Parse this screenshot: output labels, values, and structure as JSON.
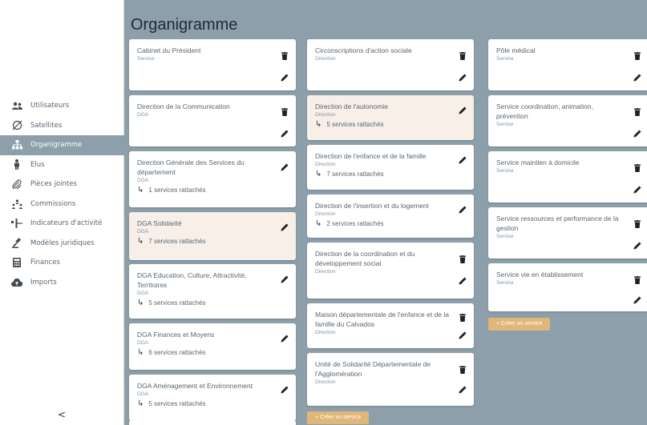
{
  "title": "Organigramme",
  "sidebar": {
    "items": [
      {
        "label": "Utilisateurs",
        "icon": "users-icon",
        "active": false
      },
      {
        "label": "Satellites",
        "icon": "satellite-icon",
        "active": false
      },
      {
        "label": "Organigramme",
        "icon": "sitemap-icon",
        "active": true
      },
      {
        "label": "Elus",
        "icon": "person-icon",
        "active": false
      },
      {
        "label": "Pièces jointes",
        "icon": "paperclip-icon",
        "active": false
      },
      {
        "label": "Commissions",
        "icon": "people-group-icon",
        "active": false
      },
      {
        "label": "Indicateurs d'activité",
        "icon": "indicator-icon",
        "active": false
      },
      {
        "label": "Modèles juridiques",
        "icon": "gavel-icon",
        "active": false
      },
      {
        "label": "Finances",
        "icon": "calculator-icon",
        "active": false
      },
      {
        "label": "Imports",
        "icon": "cloud-upload-icon",
        "active": false
      }
    ],
    "collapse_label": "<"
  },
  "columns": [
    {
      "cards": [
        {
          "title": "Cabinet du Président",
          "type": "Service",
          "link": "",
          "highlight": false
        },
        {
          "title": "Direction de la Communication",
          "type": "DGA",
          "link": "",
          "highlight": false
        },
        {
          "title": "Direction Générale des Services du département",
          "type": "DGA",
          "link": "1 services rattachés",
          "highlight": false
        },
        {
          "title": "DGA Solidarité",
          "type": "DGA",
          "link": "7 services rattachés",
          "highlight": true
        },
        {
          "title": "DGA Education, Culture, Attractivité, Territoires",
          "type": "DGA",
          "link": "5 services rattachés",
          "highlight": false
        },
        {
          "title": "DGA Finances et Moyens",
          "type": "DGA",
          "link": "6 services rattachés",
          "highlight": false
        },
        {
          "title": "DGA Aménagement et Environnement",
          "type": "DGA",
          "link": "5 services rattachés",
          "highlight": false
        }
      ]
    },
    {
      "cards": [
        {
          "title": "Circonscriptions d'action sociale",
          "type": "Direction",
          "link": "",
          "highlight": false
        },
        {
          "title": "Direction de l'autonomie",
          "type": "Direction",
          "link": "5 services rattachés",
          "highlight": true
        },
        {
          "title": "Direction de l'enfance et de la famille",
          "type": "Direction",
          "link": "7 services rattachés",
          "highlight": false
        },
        {
          "title": "Direction de l'insertion et du logement",
          "type": "Direction",
          "link": "2 services rattachés",
          "highlight": false
        },
        {
          "title": "Direction de la coordination et du développement social",
          "type": "Direction",
          "link": "",
          "highlight": false
        },
        {
          "title": "Maison départementale de l'enfance et de la famille du Calvados",
          "type": "Direction",
          "link": "",
          "highlight": false
        },
        {
          "title": "Unité de Solidarité Départementale de l'Agglomération",
          "type": "Direction",
          "link": "",
          "highlight": false
        }
      ],
      "add_label": "+ Créer un service"
    },
    {
      "cards": [
        {
          "title": "Pôle médical",
          "type": "Service",
          "link": "",
          "highlight": false
        },
        {
          "title": "Service coordination, animation, prévention",
          "type": "Service",
          "link": "",
          "highlight": false
        },
        {
          "title": "Service maintien à domicile",
          "type": "Service",
          "link": "",
          "highlight": false
        },
        {
          "title": "Service ressources et performance de la gestion",
          "type": "Service",
          "link": "",
          "highlight": false
        },
        {
          "title": "Service vie en établissement",
          "type": "Service",
          "link": "",
          "highlight": false
        }
      ],
      "add_label": "+ Créer un service"
    }
  ]
}
